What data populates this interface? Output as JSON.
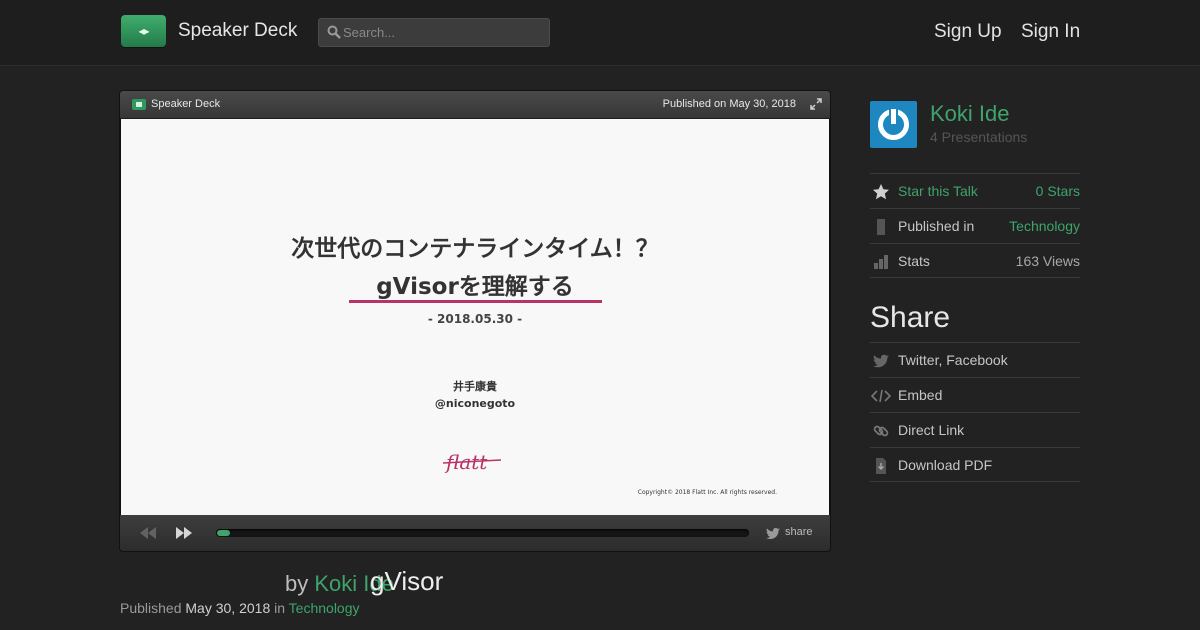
{
  "header": {
    "brand": "Speaker Deck",
    "search_placeholder": "Search...",
    "sign_up": "Sign Up",
    "sign_in": "Sign In"
  },
  "player": {
    "brand": "Speaker Deck",
    "published": "Published on May 30, 2018",
    "share_label": "share",
    "progress_fraction": 0.025
  },
  "slide": {
    "title_line1": "次世代のコンテナラインタイム！？",
    "title_line2": "gVisorを理解する",
    "date": "- 2018.05.30 -",
    "author": "井手康貴",
    "handle": "@niconegoto",
    "logo_text": "flatt",
    "copyright": "Copyright© 2018 Flatt Inc. All rights reserved."
  },
  "talk": {
    "title": "gVisor",
    "by": "by",
    "author": "Koki Ide",
    "published_label": "Published",
    "published_date": "May 30, 2018",
    "in_label": "in",
    "category": "Technology"
  },
  "sidebar": {
    "author_name": "Koki Ide",
    "presentations": "4 Presentations",
    "star_label": "Star this Talk",
    "stars": "0 Stars",
    "published_in_label": "Published in",
    "published_in_value": "Technology",
    "stats_label": "Stats",
    "stats_value": "163 Views",
    "share_heading": "Share",
    "share_items": [
      "Twitter, Facebook",
      "Embed",
      "Direct Link",
      "Download PDF"
    ]
  },
  "colors": {
    "accent": "#3fa36c",
    "slide_underline": "#b83466",
    "avatar": "#1f87bf"
  }
}
